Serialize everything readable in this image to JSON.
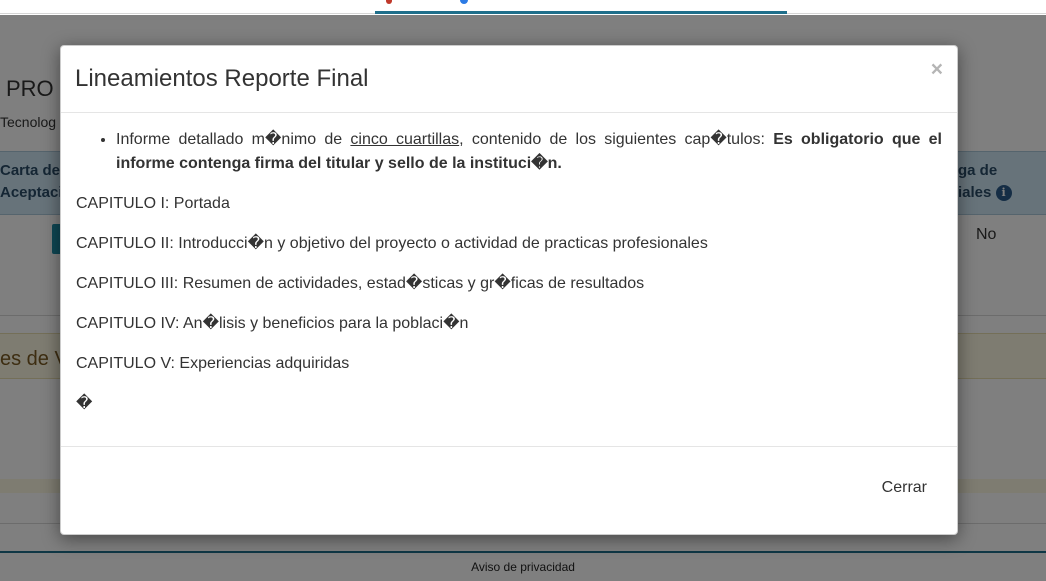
{
  "background": {
    "page_title_fragment": "PRO",
    "subtitle_fragment": "Tecnolog",
    "table": {
      "header_left": [
        "Carta de",
        "Aceptaci"
      ],
      "header_right": [
        "ga de",
        "iales"
      ],
      "row_value_right": "No"
    },
    "panel_title_fragment": "es de V",
    "footer_link": "Aviso de privacidad"
  },
  "modal": {
    "title": "Lineamientos Reporte Final",
    "close_symbol": "×",
    "bullet": {
      "lead_text": "Informe detallado m�nimo de",
      "underlined_text": "cinco cuartillas",
      "middle_text": ", contenido de los siguientes cap�tulos:",
      "bold_text": "Es obligatorio que el informe contenga firma del titular y sello de la instituci�n."
    },
    "chapters": [
      "CAPITULO I: Portada",
      "CAPITULO II: Introducci�n y objetivo del proyecto o actividad de practicas profesionales",
      "CAPITULO III: Resumen de actividades, estad�sticas y gr�ficas de resultados",
      "CAPITULO IV: An�lisis y beneficios para la poblaci�n",
      "CAPITULO V: Experiencias adquiridas"
    ],
    "trailing_char": "�",
    "footer_button": "Cerrar"
  },
  "colors": {
    "table_header_bg": "#cfe7f5",
    "panel_warning_bg": "#fcf8e3",
    "accent": "#1f6f8b"
  },
  "icons": [
    "info-icon",
    "close-icon"
  ]
}
